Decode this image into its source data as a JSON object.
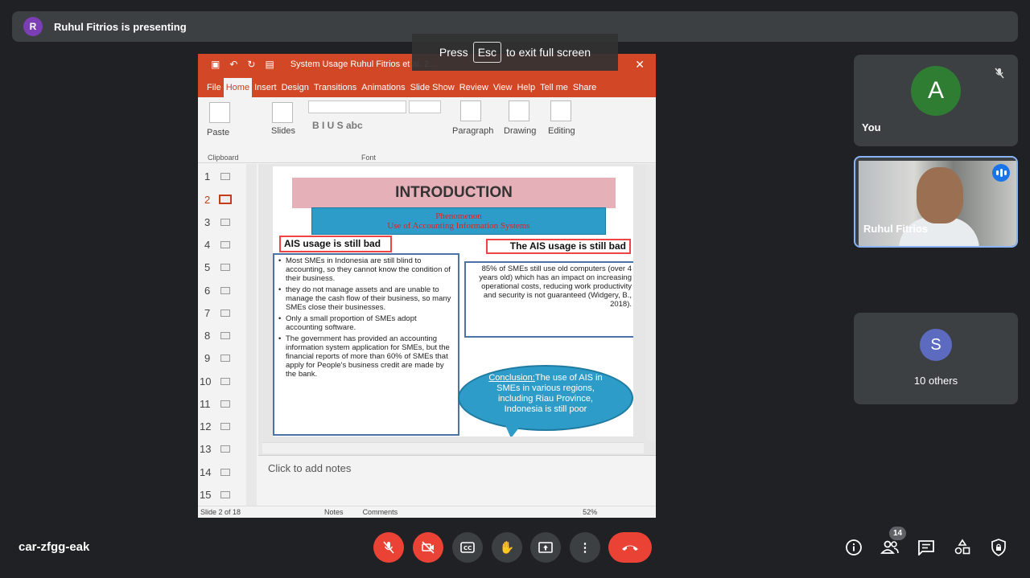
{
  "banner": {
    "avatar_letter": "R",
    "text": "Ruhul Fitrios is presenting"
  },
  "toast": {
    "press": "Press",
    "key": "Esc",
    "rest": "to exit full screen"
  },
  "ppt": {
    "doc_title": "System Usage Ruhul Fitrios et al. 2...",
    "tabs": [
      "File",
      "Home",
      "Insert",
      "Design",
      "Transitions",
      "Animations",
      "Slide Show",
      "Review",
      "View",
      "Help",
      "Tell me",
      "Share"
    ],
    "ribbon": {
      "paste": "Paste",
      "slides": "Slides",
      "clipboard": "Clipboard",
      "font": "Font",
      "paragraph": "Paragraph",
      "drawing": "Drawing",
      "editing": "Editing",
      "format_buttons": "B  I  U  S  abc"
    },
    "thumb_numbers": [
      "1",
      "2",
      "3",
      "4",
      "5",
      "6",
      "7",
      "8",
      "9",
      "10",
      "11",
      "12",
      "13",
      "14",
      "15"
    ],
    "active_slide": 2,
    "slide": {
      "title": "INTRODUCTION",
      "banner_line1": "Phenomenon",
      "banner_line2": "Use of Accounting Information Systems",
      "left_label": "AIS usage is still bad",
      "right_label": "The AIS usage is still bad",
      "left_items": [
        "Most SMEs in Indonesia are still blind to accounting, so they cannot know the condition of their business.",
        "they do not manage assets and are unable to manage the cash flow of their business, so many SMEs close their businesses.",
        "Only a small proportion of SMEs adopt accounting software.",
        "The government has provided an accounting information system application for SMEs, but the financial reports of more than 60% of SMEs that apply for People's business credit are made by the bank."
      ],
      "right_text": "85% of SMEs still use old computers (over 4 years old) which has an impact on increasing operational costs, reducing work productivity and security is not guaranteed (Widgery, B., 2018).",
      "conclusion_label": "Conclusion:",
      "conclusion_text": "The use of AIS in SMEs in various regions, including Riau Province, Indonesia is still poor"
    },
    "notes_placeholder": "Click to add notes",
    "status": {
      "slide_count": "Slide 2 of 18",
      "notes": "Notes",
      "comments": "Comments",
      "zoom": "52%"
    }
  },
  "tiles": {
    "you": {
      "letter": "A",
      "name": "You",
      "color": "#2e7d32"
    },
    "presenter": {
      "name": "Ruhul Fitrios"
    },
    "others": {
      "letter": "S",
      "name": "10 others",
      "color": "#5c6bc0"
    }
  },
  "bottom": {
    "meeting_code": "car-zfgg-eak",
    "participants_count": "14"
  }
}
